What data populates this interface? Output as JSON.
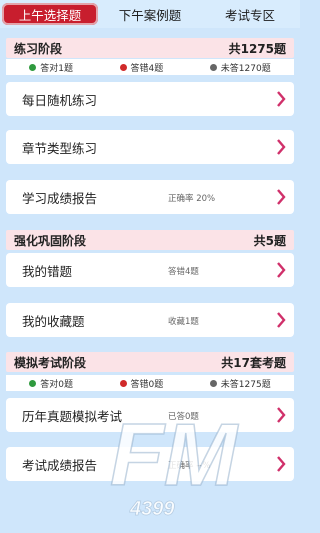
{
  "tabs": [
    {
      "label": "上午选择题",
      "active": true
    },
    {
      "label": "下午案例题",
      "active": false
    },
    {
      "label": "考试专区",
      "active": false
    }
  ],
  "sections": {
    "practice": {
      "title": "练习阶段",
      "total": "共1275题",
      "stats": {
        "correct": "答对1题",
        "wrong": "答错4题",
        "unanswered": "未答1270题"
      },
      "cards": [
        {
          "title": "每日随机练习",
          "sub": ""
        },
        {
          "title": "章节类型练习",
          "sub": ""
        },
        {
          "title": "学习成绩报告",
          "sub": "正确率 20%"
        }
      ]
    },
    "reinforce": {
      "title": "强化巩固阶段",
      "total": "共5题",
      "cards": [
        {
          "title": "我的错题",
          "sub": "答错4题"
        },
        {
          "title": "我的收藏题",
          "sub": "收藏1题"
        }
      ]
    },
    "mock": {
      "title": "模拟考试阶段",
      "total": "共17套考题",
      "stats": {
        "correct": "答对0题",
        "wrong": "答错0题",
        "unanswered": "未答1275题"
      },
      "cards": [
        {
          "title": "历年真题模拟考试",
          "sub": "已答0题"
        },
        {
          "title": "考试成绩报告",
          "sub": "正确率 --%"
        }
      ]
    }
  },
  "watermark": {
    "big": "FM",
    "small": "4399"
  },
  "colors": {
    "accent": "#c81e2e",
    "background": "#cfe6fb",
    "header": "#fbe3e7",
    "chevron": "#d0306a"
  }
}
